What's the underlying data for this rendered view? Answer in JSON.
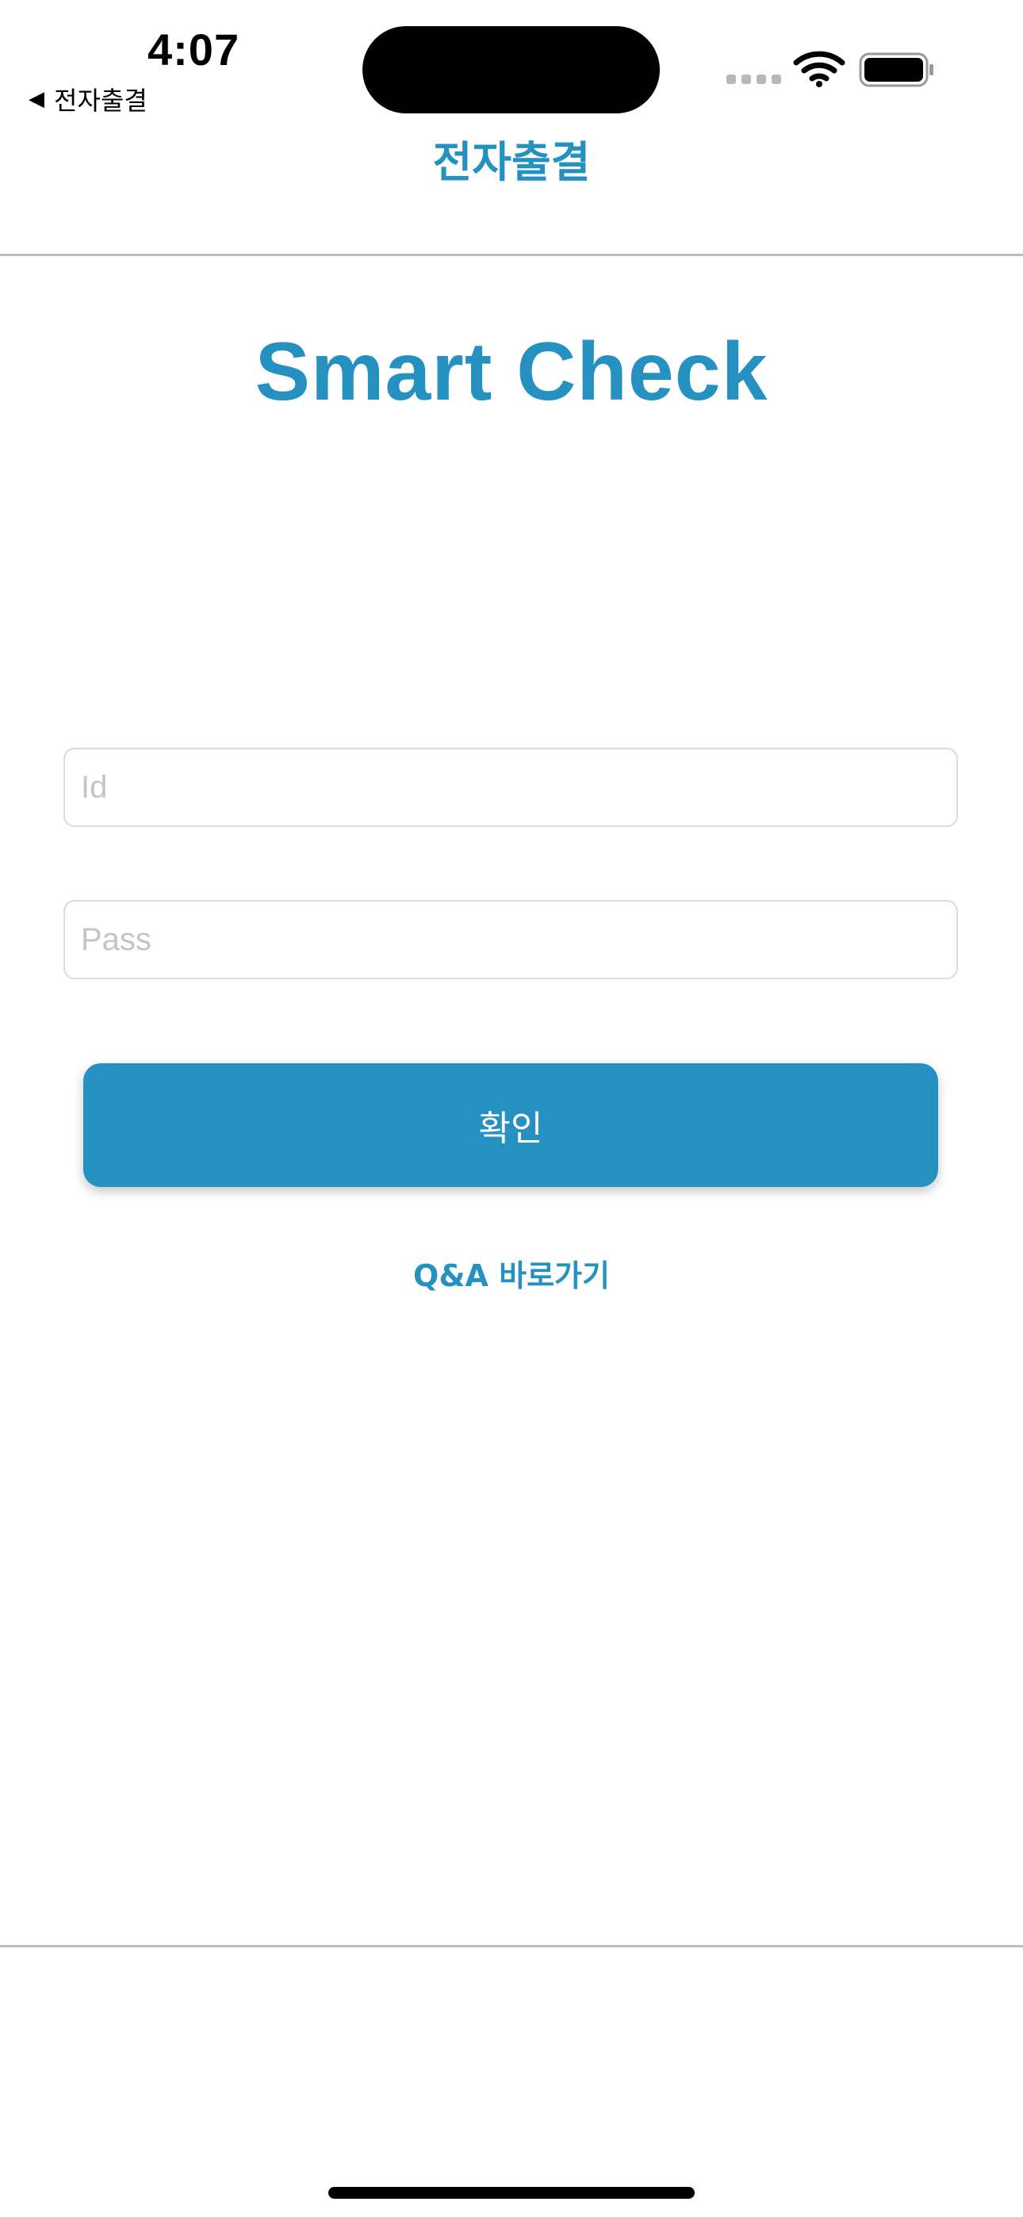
{
  "status_bar": {
    "time": "4:07",
    "back_app": "전자출결",
    "back_arrow": "◀",
    "wifi_icon": "wifi-icon",
    "battery_icon": "battery-full-icon"
  },
  "header": {
    "title": "전자출결"
  },
  "app": {
    "title": "Smart Check"
  },
  "form": {
    "id_placeholder": "Id",
    "id_value": "",
    "pass_placeholder": "Pass",
    "pass_value": "",
    "confirm_label": "확인"
  },
  "links": {
    "qa_label": "Q&A 바로가기"
  },
  "colors": {
    "accent": "#2591c0",
    "divider": "#bdbdbd",
    "placeholder": "#c4c4c4"
  }
}
